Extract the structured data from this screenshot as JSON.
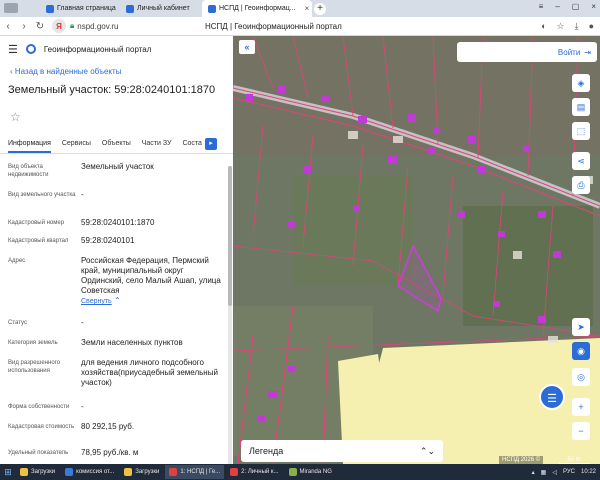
{
  "browser": {
    "tabs": [
      {
        "label": "Главная страница",
        "active": false
      },
      {
        "label": "Личный кабинет",
        "active": false
      },
      {
        "label": "НСПД | Геоинформац...",
        "active": true
      }
    ],
    "url": "nspd.gov.ru",
    "page_title": "НСПД | Геоинформационный портал"
  },
  "panel": {
    "portal_title": "Геоинформационный портал",
    "back_link": "Назад в найденные объекты",
    "object_title": "Земельный участок: 59:28:0240101:1870",
    "tabs": [
      "Информация",
      "Сервисы",
      "Объекты",
      "Части ЗУ",
      "Соста"
    ],
    "rows": [
      {
        "key": "Вид объекта недвижимости",
        "value": "Земельный участок"
      },
      {
        "key": "Вид земельного участка",
        "value": "-"
      },
      {
        "key": "Кадастровый номер",
        "value": "59:28:0240101:1870"
      },
      {
        "key": "Кадастровый квартал",
        "value": "59:28:0240101"
      },
      {
        "key": "Адрес",
        "value": "Российская Федерация, Пермский край, муниципальный округ Ординский, село Малый Ашап, улица Советская"
      },
      {
        "key": "Статус",
        "value": "-"
      },
      {
        "key": "Категория земель",
        "value": "Земли населенных пунктов"
      },
      {
        "key": "Вид разрешенного использования",
        "value": "для ведения личного подсобного хозяйства(приусадебный земельный участок)"
      },
      {
        "key": "Форма собственности",
        "value": "-"
      },
      {
        "key": "Кадастровая стоимость",
        "value": "80 292,15 руб."
      },
      {
        "key": "Удельный показатель",
        "value": "78,95 руб./кв. м"
      }
    ],
    "collapse_link": "Свернуть"
  },
  "map": {
    "login_label": "Войти",
    "legend_label": "Легенда",
    "credit": "НСПД 2026 ©",
    "scale": "50 m",
    "colors": {
      "parcel_line": "#e0447a",
      "building": "#c23ad6",
      "selected": "#d23be0",
      "field": "#f5f0b0"
    }
  },
  "taskbar": {
    "items": [
      {
        "label": "Загрузки",
        "active": false
      },
      {
        "label": "комиссия от...",
        "active": false
      },
      {
        "label": "Загрузки",
        "active": false
      },
      {
        "label": "1: НСПД | Ге...",
        "active": true
      },
      {
        "label": "2: Личный к...",
        "active": false
      },
      {
        "label": "Miranda NG",
        "active": false
      }
    ],
    "lang": "РУС",
    "time": "10:22"
  }
}
